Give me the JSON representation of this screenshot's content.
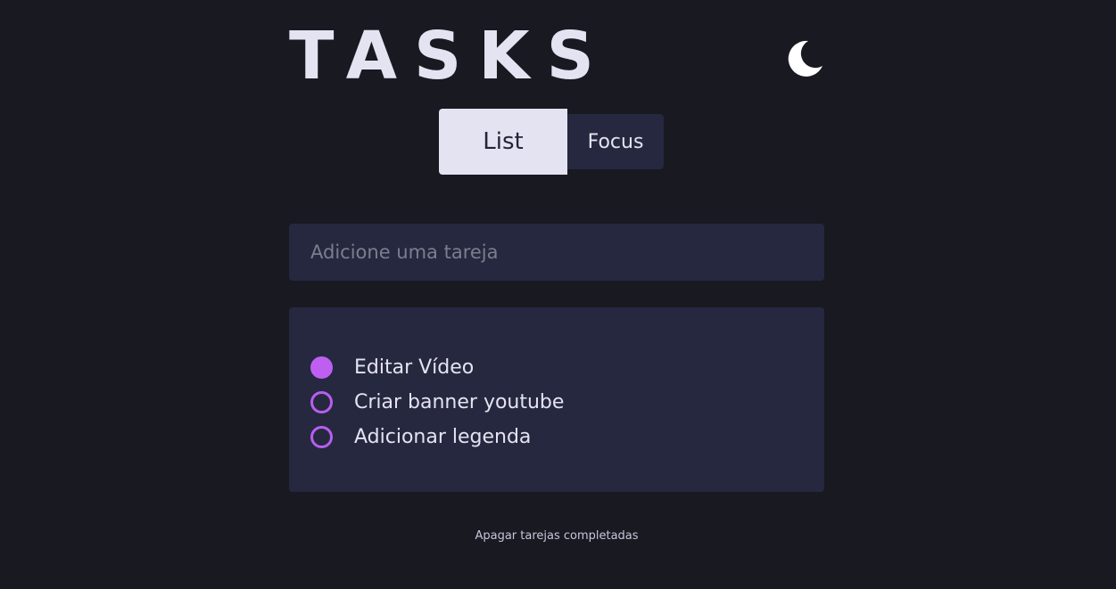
{
  "app": {
    "title": "TASKS",
    "theme_icon": "moon-icon"
  },
  "tabs": [
    {
      "label": "List",
      "active": true
    },
    {
      "label": "Focus",
      "active": false
    }
  ],
  "new_task": {
    "placeholder": "Adicione uma tareja",
    "value": ""
  },
  "tasks": [
    {
      "label": "Editar Vídeo",
      "completed": true
    },
    {
      "label": "Criar banner youtube",
      "completed": false
    },
    {
      "label": "Adicionar legenda",
      "completed": false
    }
  ],
  "footer": {
    "clear_label": "Apagar tarejas completadas"
  },
  "colors": {
    "background": "#191922",
    "surface": "#262840",
    "text": "#e4e3f1",
    "accent": "#bf5ff2"
  }
}
